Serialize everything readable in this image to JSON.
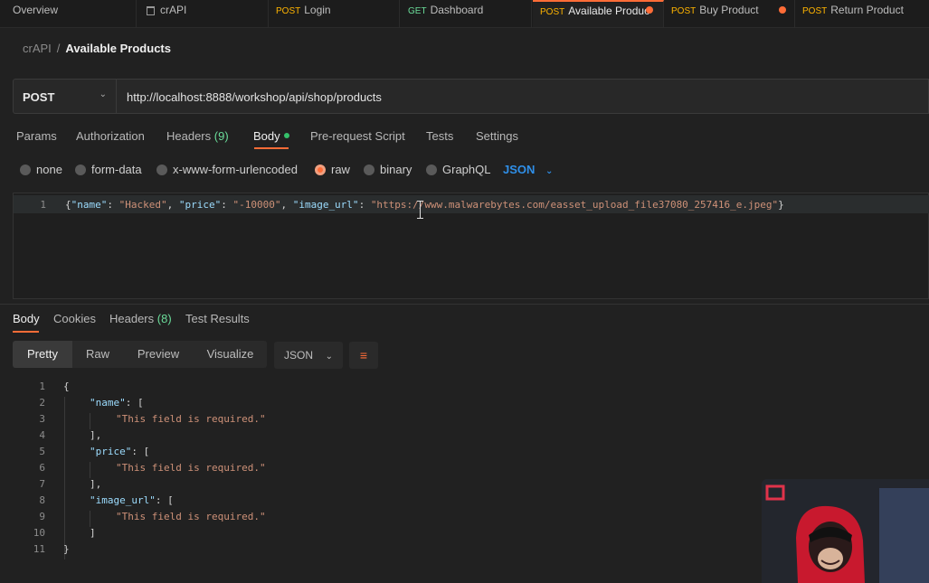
{
  "tabs": [
    {
      "method": "",
      "label": "Overview"
    },
    {
      "method": "",
      "label": "crAPI",
      "icon": "trash-icon"
    },
    {
      "method": "POST",
      "label": "Login"
    },
    {
      "method": "GET",
      "label": "Dashboard"
    },
    {
      "method": "POST",
      "label": "Available Produc",
      "active": true,
      "unsaved": true
    },
    {
      "method": "POST",
      "label": "Buy Product",
      "unsaved": true
    },
    {
      "method": "POST",
      "label": "Return Product"
    }
  ],
  "breadcrumb": {
    "collection": "crAPI",
    "separator": "/",
    "current": "Available Products"
  },
  "request": {
    "method": "POST",
    "url": "http://localhost:8888/workshop/api/shop/products",
    "tabs": [
      {
        "label": "Params"
      },
      {
        "label": "Authorization"
      },
      {
        "label": "Headers",
        "count": "(9)"
      },
      {
        "label": "Body",
        "active": true
      },
      {
        "label": "Pre-request Script"
      },
      {
        "label": "Tests"
      },
      {
        "label": "Settings"
      }
    ],
    "body_modes": [
      "none",
      "form-data",
      "x-www-form-urlencoded",
      "raw",
      "binary",
      "GraphQL"
    ],
    "selected_mode": "raw",
    "language": "JSON",
    "body_line": {
      "num": "1",
      "open": "{",
      "k1": "\"name\"",
      "v1": "\"Hacked\"",
      "k2": "\"price\"",
      "v2": "\"-10000\"",
      "k3": "\"image_url\"",
      "v3": "\"https://www.malwarebytes.com/easset_upload_file37080_257416_e.jpeg\"",
      "close": "}"
    }
  },
  "response": {
    "tabs": [
      {
        "label": "Body",
        "active": true
      },
      {
        "label": "Cookies"
      },
      {
        "label": "Headers",
        "count": "(8)"
      },
      {
        "label": "Test Results"
      }
    ],
    "views": [
      "Pretty",
      "Raw",
      "Preview",
      "Visualize"
    ],
    "active_view": "Pretty",
    "format": "JSON",
    "lines": [
      {
        "n": "1",
        "t": "{"
      },
      {
        "n": "2",
        "k": "\"name\"",
        "t": ": ["
      },
      {
        "n": "3",
        "s": "\"This field is required.\""
      },
      {
        "n": "4",
        "t": "],"
      },
      {
        "n": "5",
        "k": "\"price\"",
        "t": ": ["
      },
      {
        "n": "6",
        "s": "\"This field is required.\""
      },
      {
        "n": "7",
        "t": "],"
      },
      {
        "n": "8",
        "k": "\"image_url\"",
        "t": ": ["
      },
      {
        "n": "9",
        "s": "\"This field is required.\""
      },
      {
        "n": "10",
        "t": "]"
      },
      {
        "n": "11",
        "t": "}"
      }
    ]
  },
  "colors": {
    "accent": "#ff6c37",
    "json_blue": "#2f8fe8",
    "count_green": "#6bdd9a"
  }
}
